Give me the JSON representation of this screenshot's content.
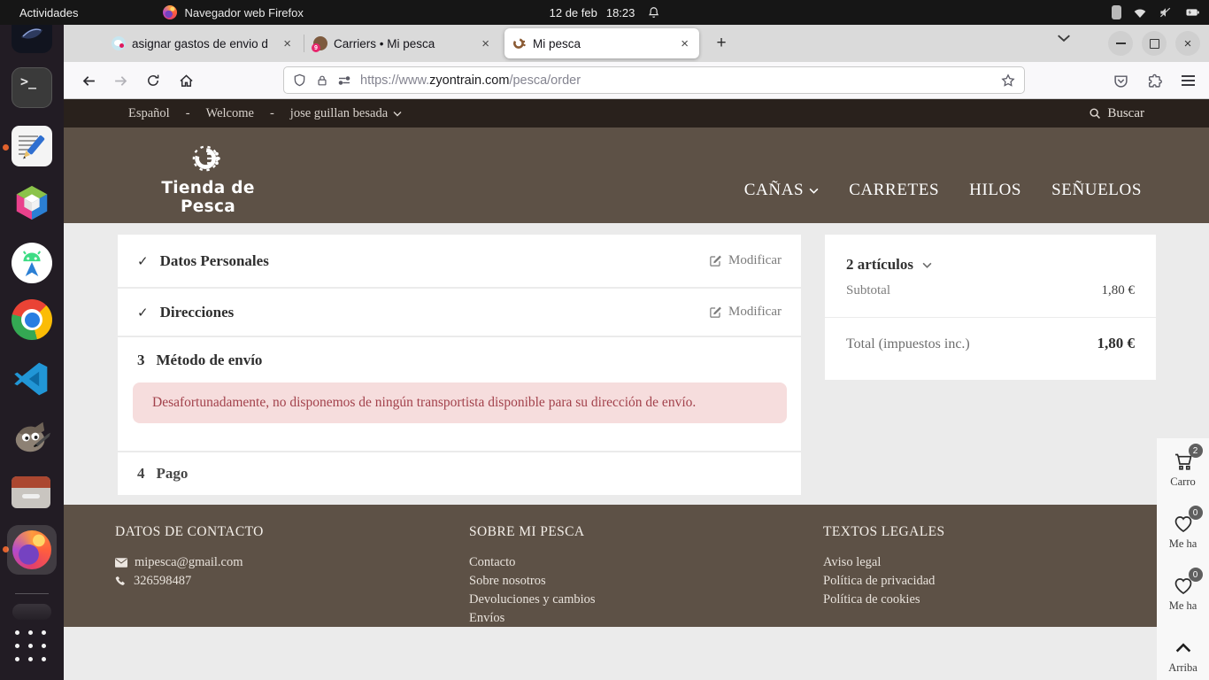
{
  "icons": {
    "check": "✓",
    "close": "×",
    "plus": "+"
  },
  "desktop": {
    "activities_label": "Actividades",
    "app_menu_label": "Navegador web Firefox",
    "clock_date": "12 de feb",
    "clock_time": "18:23",
    "dock_items": [
      "dark-app",
      "terminal",
      "text-editor",
      "boxes-cube",
      "android-studio",
      "chrome",
      "vscode",
      "gimp",
      "files",
      "firefox-active",
      "drawer",
      "app-grid"
    ],
    "terminal_glyph": ">_"
  },
  "browser": {
    "tabs": [
      {
        "title": "asignar gastos de envio d"
      },
      {
        "title": "Carriers • Mi pesca",
        "favicon_badge": "9"
      },
      {
        "title": "Mi pesca"
      }
    ],
    "url": {
      "prefix": "https://www.",
      "domain": "zyontrain.com",
      "path": "/pesca/order"
    }
  },
  "site": {
    "topbar": {
      "language": "Español",
      "sep1": "-",
      "welcome": "Welcome",
      "sep2": "-",
      "user": "jose guillan besada",
      "search_label": "Buscar"
    },
    "header": {
      "logo_text": "Tienda de Pesca",
      "nav": [
        {
          "label": "CAÑAS"
        },
        {
          "label": "CARRETES"
        },
        {
          "label": "HILOS"
        },
        {
          "label": "SEÑUELOS"
        }
      ]
    },
    "checkout": {
      "steps": [
        {
          "title": "Datos Personales",
          "action": "Modificar"
        },
        {
          "title": "Direcciones",
          "action": "Modificar"
        },
        {
          "number": "3",
          "title": "Método de envío"
        },
        {
          "number": "4",
          "title": "Pago"
        }
      ],
      "shipping_alert": "Desafortunadamente, no disponemos de ningún transportista disponible para su dirección de envío."
    },
    "summary": {
      "items_count": "2 artículos",
      "subtotal_label": "Subtotal",
      "subtotal_value": "1,80 €",
      "total_label": "Total (impuestos inc.)",
      "total_value": "1,80 €"
    },
    "footer": {
      "contact": {
        "heading": "DATOS DE CONTACTO",
        "email": "mipesca@gmail.com",
        "phone": "326598487"
      },
      "about": {
        "heading": "SOBRE MI PESCA",
        "links": [
          "Contacto",
          "Sobre nosotros",
          "Devoluciones y cambios",
          "Envíos"
        ]
      },
      "legal": {
        "heading": "TEXTOS LEGALES",
        "links": [
          "Aviso legal",
          "Política de privacidad",
          "Política de cookies"
        ]
      }
    },
    "floating": {
      "cart_label": "Carro",
      "cart_badge": "2",
      "wishlist1_label": "Me ha",
      "wishlist1_badge": "0",
      "wishlist2_label": "Me ha",
      "wishlist2_badge": "0",
      "top_label": "Arriba"
    }
  }
}
